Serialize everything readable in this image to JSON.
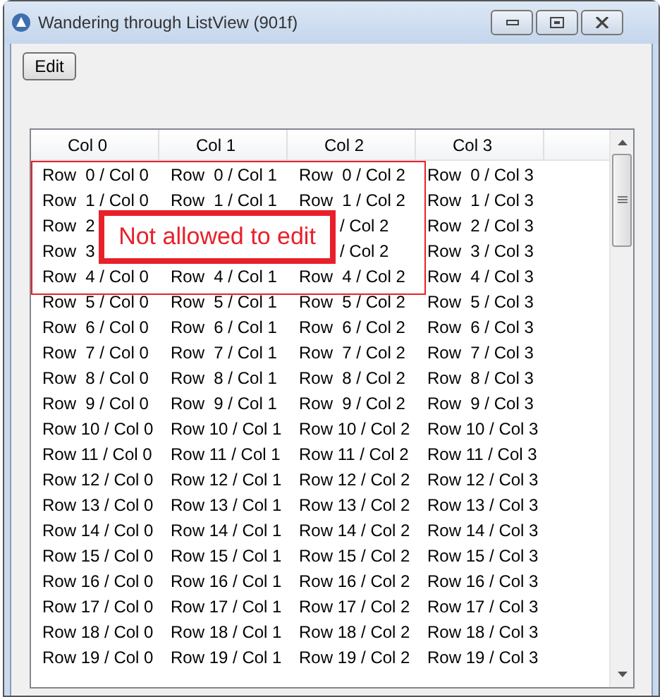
{
  "window": {
    "title": "Wandering through ListView (901f)"
  },
  "toolbar": {
    "edit_button": "Edit"
  },
  "table": {
    "columns": [
      "Col 0",
      "Col 1",
      "Col 2",
      "Col 3"
    ],
    "rows": [
      {
        "col_0": "Row  0 / Col 0",
        "col_1": "Row  0 / Col 1",
        "col_2": "Row  0 / Col 2",
        "col_3": "Row  0 / Col 3"
      },
      {
        "col_0": "Row  1 / Col 0",
        "col_1": "Row  1 / Col 1",
        "col_2": "Row  1 / Col 2",
        "col_3": "Row  1 / Col 3"
      },
      {
        "col_0": "Row  2",
        "col_2": "/ Col 2",
        "col_3": "Row  2 / Col 3"
      },
      {
        "col_0": "Row  3",
        "col_2": "/ Col 2",
        "col_3": "Row  3 / Col 3"
      },
      {
        "col_0": "Row  4 / Col 0",
        "col_1": "Row  4 / Col 1",
        "col_2": "Row  4 / Col 2",
        "col_3": "Row  4 / Col 3"
      },
      {
        "col_0": "Row  5 / Col 0",
        "col_1": "Row  5 / Col 1",
        "col_2": "Row  5 / Col 2",
        "col_3": "Row  5 / Col 3"
      },
      {
        "col_0": "Row  6 / Col 0",
        "col_1": "Row  6 / Col 1",
        "col_2": "Row  6 / Col 2",
        "col_3": "Row  6 / Col 3"
      },
      {
        "col_0": "Row  7 / Col 0",
        "col_1": "Row  7 / Col 1",
        "col_2": "Row  7 / Col 2",
        "col_3": "Row  7 / Col 3"
      },
      {
        "col_0": "Row  8 / Col 0",
        "col_1": "Row  8 / Col 1",
        "col_2": "Row  8 / Col 2",
        "col_3": "Row  8 / Col 3"
      },
      {
        "col_0": "Row  9 / Col 0",
        "col_1": "Row  9 / Col 1",
        "col_2": "Row  9 / Col 2",
        "col_3": "Row  9 / Col 3"
      },
      {
        "col_0": "Row 10 / Col 0",
        "col_1": "Row 10 / Col 1",
        "col_2": "Row 10 / Col 2",
        "col_3": "Row 10 / Col 3"
      },
      {
        "col_0": "Row 11 / Col 0",
        "col_1": "Row 11 / Col 1",
        "col_2": "Row 11 / Col 2",
        "col_3": "Row 11 / Col 3"
      },
      {
        "col_0": "Row 12 / Col 0",
        "col_1": "Row 12 / Col 1",
        "col_2": "Row 12 / Col 2",
        "col_3": "Row 12 / Col 3"
      },
      {
        "col_0": "Row 13 / Col 0",
        "col_1": "Row 13 / Col 1",
        "col_2": "Row 13 / Col 2",
        "col_3": "Row 13 / Col 3"
      },
      {
        "col_0": "Row 14 / Col 0",
        "col_1": "Row 14 / Col 1",
        "col_2": "Row 14 / Col 2",
        "col_3": "Row 14 / Col 3"
      },
      {
        "col_0": "Row 15 / Col 0",
        "col_1": "Row 15 / Col 1",
        "col_2": "Row 15 / Col 2",
        "col_3": "Row 15 / Col 3"
      },
      {
        "col_0": "Row 16 / Col 0",
        "col_1": "Row 16 / Col 1",
        "col_2": "Row 16 / Col 2",
        "col_3": "Row 16 / Col 3"
      },
      {
        "col_0": "Row 17 / Col 0",
        "col_1": "Row 17 / Col 1",
        "col_2": "Row 17 / Col 2",
        "col_3": "Row 17 / Col 3"
      },
      {
        "col_0": "Row 18 / Col 0",
        "col_1": "Row 18 / Col 1",
        "col_2": "Row 18 / Col 2",
        "col_3": "Row 18 / Col 3"
      },
      {
        "col_0": "Row 19 / Col 0",
        "col_1": "Row 19 / Col 1",
        "col_2": "Row 19 / Col 2",
        "col_3": "Row 19 / Col 3"
      }
    ]
  },
  "annotation": {
    "callout": "Not allowed to edit"
  }
}
